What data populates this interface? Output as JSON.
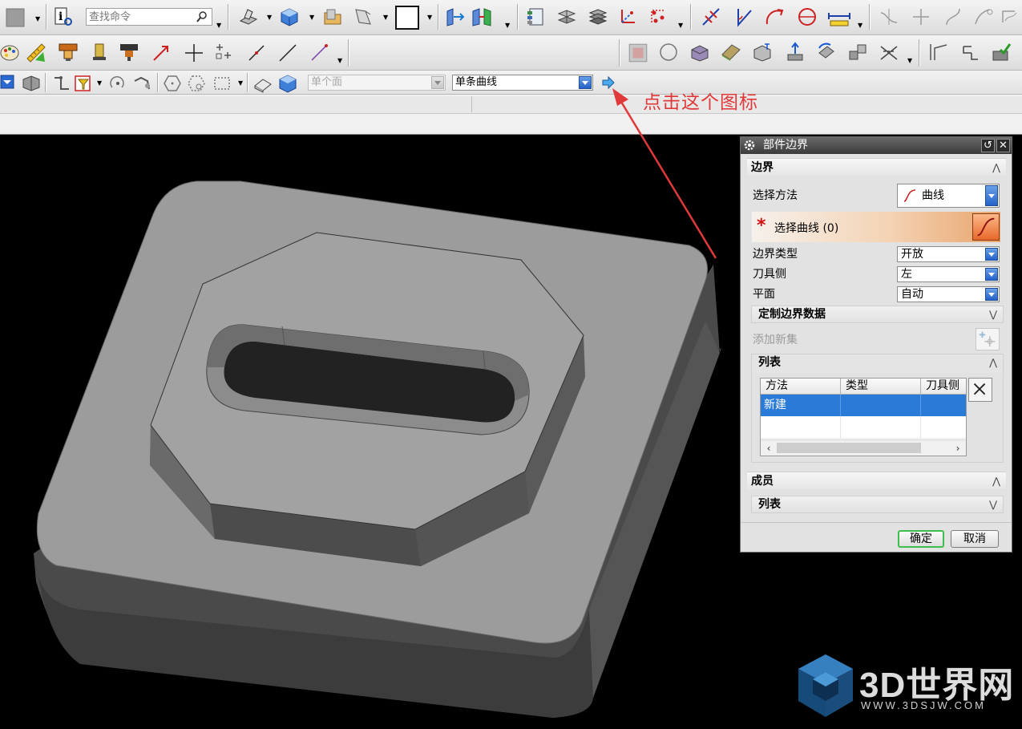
{
  "toolbar": {
    "search_placeholder": "查找命令"
  },
  "selection_bar": {
    "filter_value": "单个面",
    "curve_rule_value": "单条曲线"
  },
  "annotation": {
    "text": "点击这个图标",
    "color": "#e0393a"
  },
  "dialog": {
    "title": "部件边界",
    "section_boundary": "边界",
    "method_label": "选择方法",
    "method_value": "曲线",
    "select_curve_label": "选择曲线 (0)",
    "boundary_type_label": "边界类型",
    "boundary_type_value": "开放",
    "tool_side_label": "刀具侧",
    "tool_side_value": "左",
    "plane_label": "平面",
    "plane_value": "自动",
    "custom_boundary_data": "定制边界数据",
    "add_new_set": "添加新集",
    "list_header": "列表",
    "table": {
      "columns": [
        "方法",
        "类型",
        "刀具侧"
      ],
      "rows": [
        [
          "新建",
          "",
          ""
        ]
      ]
    },
    "members_header": "成员",
    "members_list_header": "列表",
    "ok": "确定",
    "cancel": "取消"
  },
  "watermark": {
    "main": "3D世界网",
    "sub": "WWW.3DSJW.COM"
  },
  "colors": {
    "selected_row": "#2a7ad8",
    "model_top": "#9a9a9a",
    "viewport_bg": "#000000"
  }
}
